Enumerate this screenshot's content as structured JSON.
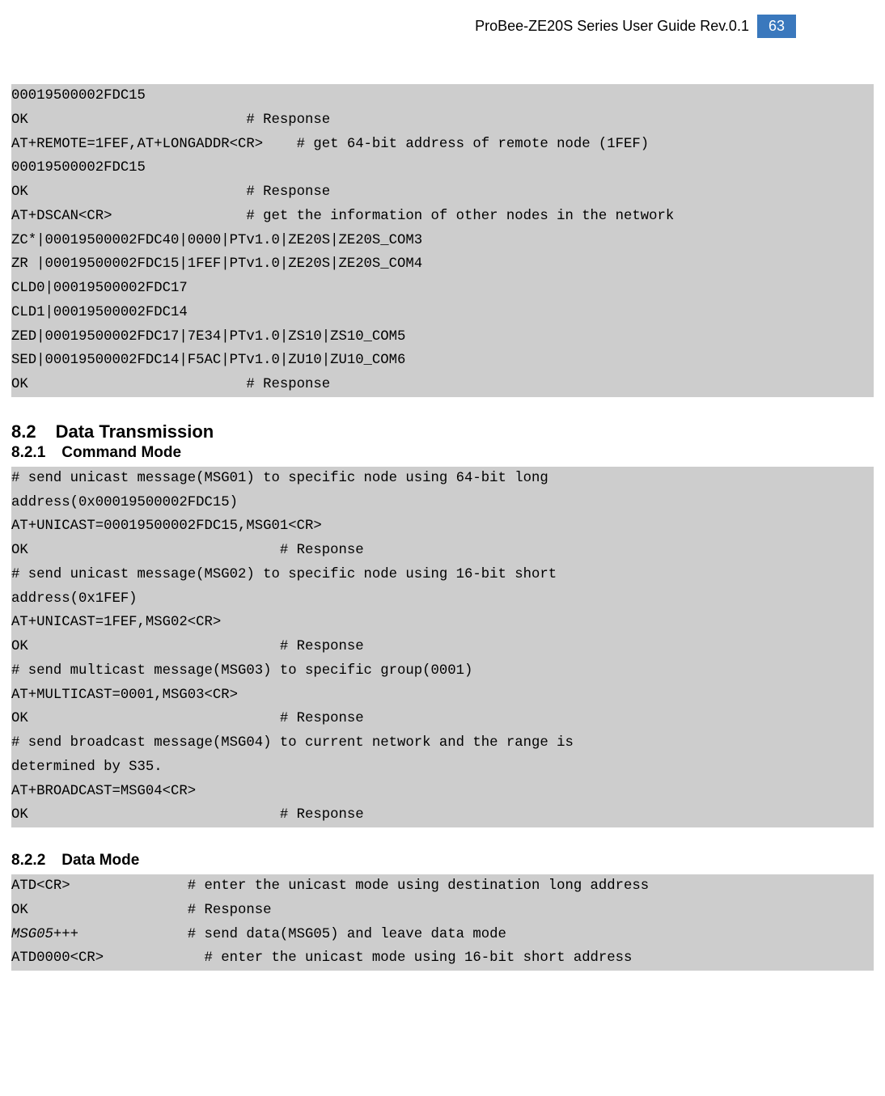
{
  "header": {
    "title": "ProBee-ZE20S Series User Guide Rev.0.1",
    "page": "63"
  },
  "sections": {
    "s82_num": "8.2",
    "s82_title": "Data Transmission",
    "s821_num": "8.2.1",
    "s821_title": "Command Mode",
    "s822_num": "8.2.2",
    "s822_title": "Data Mode"
  },
  "code1": "00019500002FDC15\nOK                          # Response\nAT+REMOTE=1FEF,AT+LONGADDR<CR>    # get 64-bit address of remote node (1FEF)\n00019500002FDC15\nOK                          # Response\nAT+DSCAN<CR>                # get the information of other nodes in the network\nZC*|00019500002FDC40|0000|PTv1.0|ZE20S|ZE20S_COM3\nZR |00019500002FDC15|1FEF|PTv1.0|ZE20S|ZE20S_COM4\nCLD0|00019500002FDC17\nCLD1|00019500002FDC14\nZED|00019500002FDC17|7E34|PTv1.0|ZS10|ZS10_COM5\nSED|00019500002FDC14|F5AC|PTv1.0|ZU10|ZU10_COM6\nOK                          # Response",
  "code2": "# send unicast message(MSG01) to specific node using 64-bit long\naddress(0x00019500002FDC15)\nAT+UNICAST=00019500002FDC15,MSG01<CR>\nOK                              # Response\n# send unicast message(MSG02) to specific node using 16-bit short\naddress(0x1FEF)\nAT+UNICAST=1FEF,MSG02<CR>\nOK                              # Response\n# send multicast message(MSG03) to specific group(0001)\nAT+MULTICAST=0001,MSG03<CR>\nOK                              # Response\n# send broadcast message(MSG04) to current network and the range is\ndetermined by S35.\nAT+BROADCAST=MSG04<CR>\nOK                              # Response",
  "code3_l1": "ATD<CR>              # enter the unicast mode using destination long address",
  "code3_l2": "OK                   # Response",
  "code3_l3_a": "MSG05",
  "code3_l3_b": "+++             # send data(MSG05) and leave data mode",
  "code3_l4": "ATD0000<CR>            # enter the unicast mode using 16-bit short address"
}
